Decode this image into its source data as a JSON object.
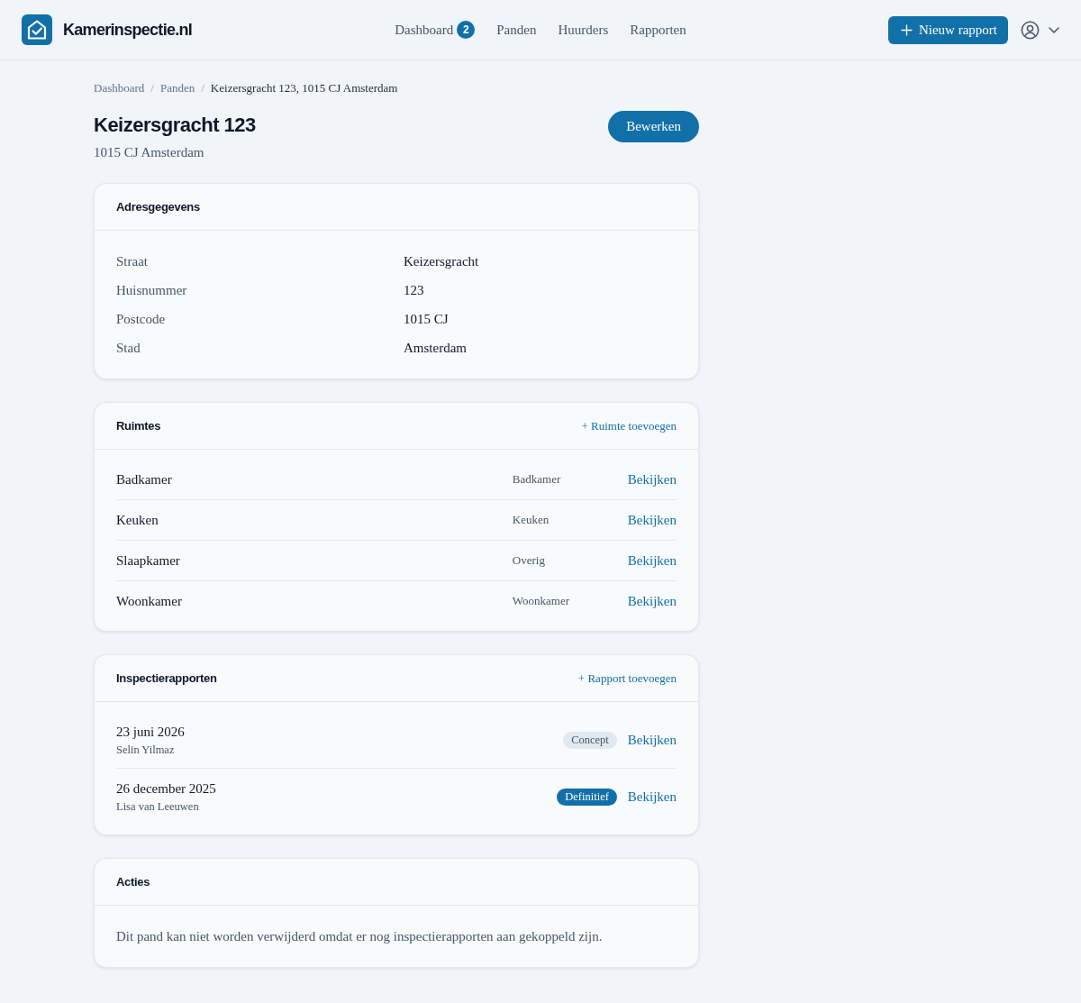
{
  "header": {
    "brand": "Kamerinspectie.nl",
    "nav": [
      {
        "label": "Dashboard",
        "badge": "2",
        "selected": false
      },
      {
        "label": "Panden",
        "selected": false
      },
      {
        "label": "Huurders",
        "selected": false
      },
      {
        "label": "Rapporten",
        "selected": false
      }
    ],
    "new_report_button": "Nieuw rapport"
  },
  "breadcrumb": [
    {
      "label": "Dashboard",
      "current": false
    },
    {
      "separator": "/",
      "label": "Panden",
      "current": false
    },
    {
      "separator": "/",
      "label": "Keizersgracht 123, 1015 CJ Amsterdam",
      "current": true
    }
  ],
  "page": {
    "title": "Keizersgracht 123",
    "subtitle": "1015 CJ Amsterdam",
    "edit_button": "Bewerken"
  },
  "address_card": {
    "title": "Adresgegevens",
    "fields": [
      {
        "label": "Straat",
        "value": "Keizersgracht"
      },
      {
        "label": "Huisnummer",
        "value": "123"
      },
      {
        "label": "Postcode",
        "value": "1015 CJ"
      },
      {
        "label": "Stad",
        "value": "Amsterdam"
      }
    ]
  },
  "rooms_card": {
    "title": "Ruimtes",
    "add_link": "+ Ruimte toevoegen",
    "rooms": [
      {
        "name": "Badkamer",
        "type": "Badkamer",
        "action": "Bekijken"
      },
      {
        "name": "Keuken",
        "type": "Keuken",
        "action": "Bekijken"
      },
      {
        "name": "Slaapkamer",
        "type": "Overig",
        "action": "Bekijken"
      },
      {
        "name": "Woonkamer",
        "type": "Woonkamer",
        "action": "Bekijken"
      }
    ]
  },
  "reports_card": {
    "title": "Inspectierapporten",
    "add_link": "+ Rapport toevoegen",
    "reports": [
      {
        "date": "23 juni 2026",
        "inspector": "Selin Yilmaz",
        "status": "Concept",
        "kind": "concept",
        "action": "Bekijken"
      },
      {
        "date": "26 december 2025",
        "inspector": "Lisa van Leeuwen",
        "status": "Definitief",
        "kind": "final",
        "action": "Bekijken"
      }
    ]
  },
  "actions_card": {
    "title": "Acties",
    "message": "Dit pand kan niet worden verwijderd omdat er nog inspectierapporten aan gekoppeld zijn."
  }
}
